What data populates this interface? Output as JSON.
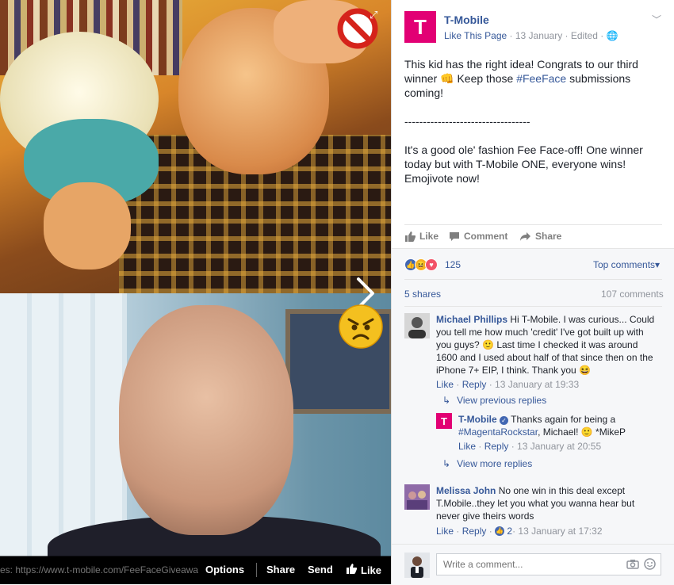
{
  "photo": {
    "footer_url": "es: https://www.t-mobile.com/FeeFaceGiveaway",
    "options_label": "Options",
    "share_label": "Share",
    "send_label": "Send",
    "like_label": "Like"
  },
  "post": {
    "page_name": "T-Mobile",
    "like_page_link": "Like This Page",
    "meta_date": " · 13 January · Edited · ",
    "logo_text": "T",
    "text_line1_a": "This kid has the right idea! Congrats to our third winner 👊 Keep those ",
    "text_hashtag": "#FeeFace",
    "text_line1_b": " submissions coming!",
    "text_divider": "----------------------------------",
    "text_line2": "It's a good ole' fashion Fee Face-off! One winner today but with T-Mobile ONE, everyone wins! Emojivote now!"
  },
  "actions": {
    "like": "Like",
    "comment": "Comment",
    "share": "Share"
  },
  "reactions": {
    "count": "125",
    "top_comments": "Top comments",
    "shares": "5 shares",
    "comments": "107 comments"
  },
  "comments": [
    {
      "name": "Michael Phillips",
      "text": " Hi T-Mobile. I was curious... Could you tell me how much 'credit' I've got built up with you guys? 🙂 Last time I checked it was around 1600 and I used about half of that since then on the iPhone 7+ EIP, I think. Thank you 😆",
      "like": "Like",
      "reply": "Reply",
      "meta": " · 13 January at 19:33"
    },
    {
      "name": "Melissa John",
      "text": " No one win in this deal except T.Mobile..they let you what you wanna hear but never give theirs words",
      "like": "Like",
      "reply": "Reply",
      "likes": "2",
      "meta": " · 13 January at 17:32"
    }
  ],
  "replies": {
    "view_previous": "View previous replies",
    "view_more": "View more replies",
    "reply_name": "T-Mobile",
    "reply_text": " Thanks again for being a ",
    "reply_hashtag": "#MagentaRockstar",
    "reply_text_b": ", Michael! 🙂 *MikeP",
    "reply_like": "Like",
    "reply_reply": "Reply",
    "reply_meta": " · 13 January at 20:55"
  },
  "composer": {
    "placeholder": "Write a comment..."
  },
  "colors": {
    "brand": "#e20074",
    "link": "#365899"
  }
}
